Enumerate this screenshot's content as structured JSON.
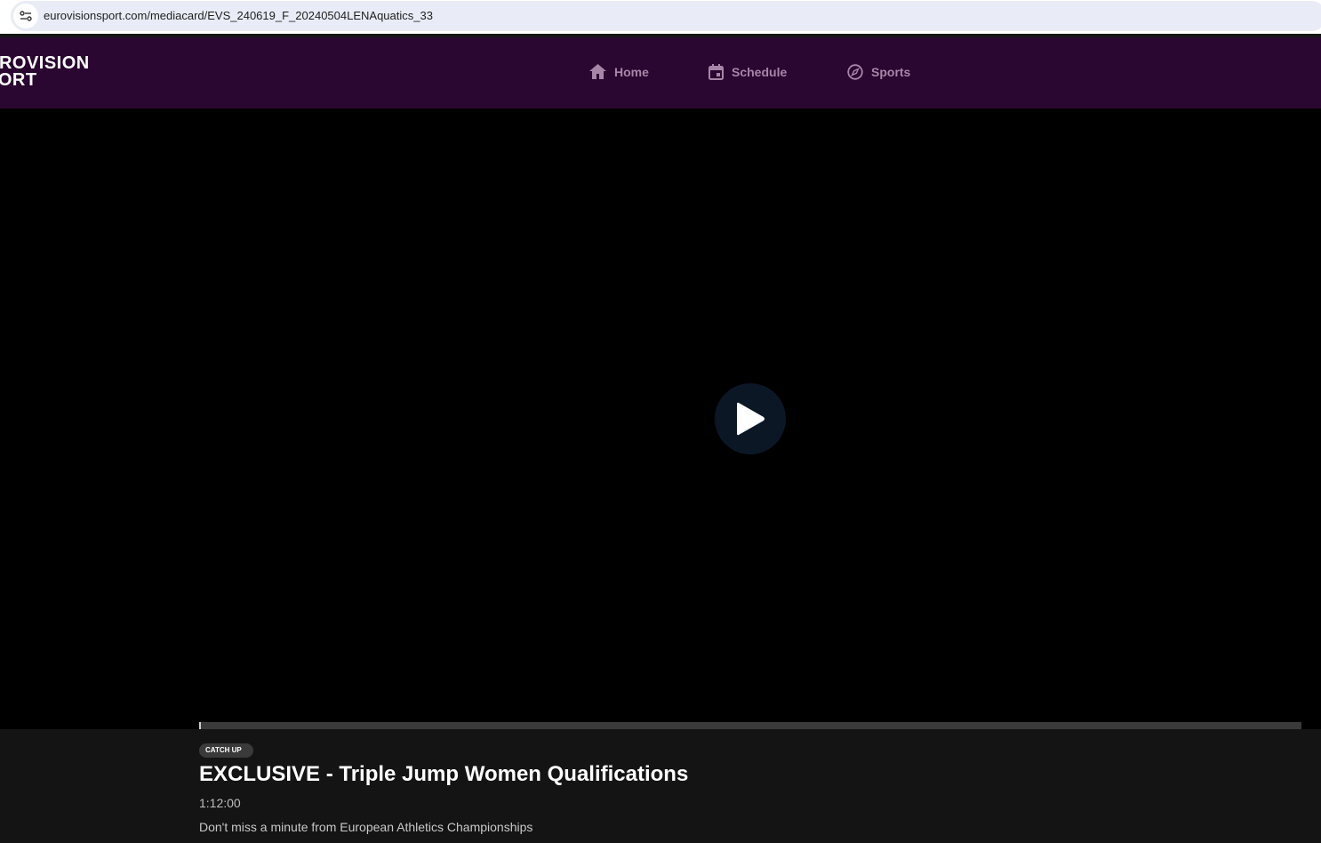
{
  "browser": {
    "url": "eurovisionsport.com/mediacard/EVS_240619_F_20240504LENAquatics_33"
  },
  "header": {
    "logo_line1": "UROVISION",
    "logo_line2": "PORT",
    "nav": [
      {
        "label": "Home",
        "icon": "home-icon"
      },
      {
        "label": "Schedule",
        "icon": "calendar-icon"
      },
      {
        "label": "Sports",
        "icon": "compass-icon"
      }
    ]
  },
  "player": {
    "progress_percent": 0.1
  },
  "media": {
    "badge": "CATCH UP",
    "title": "EXCLUSIVE - Triple Jump Women Qualifications",
    "duration": "1:12:00",
    "description": "Don't miss a minute from European Athletics Championships"
  },
  "colors": {
    "header_bg": "#2a0730",
    "nav_text": "#a885a8"
  }
}
